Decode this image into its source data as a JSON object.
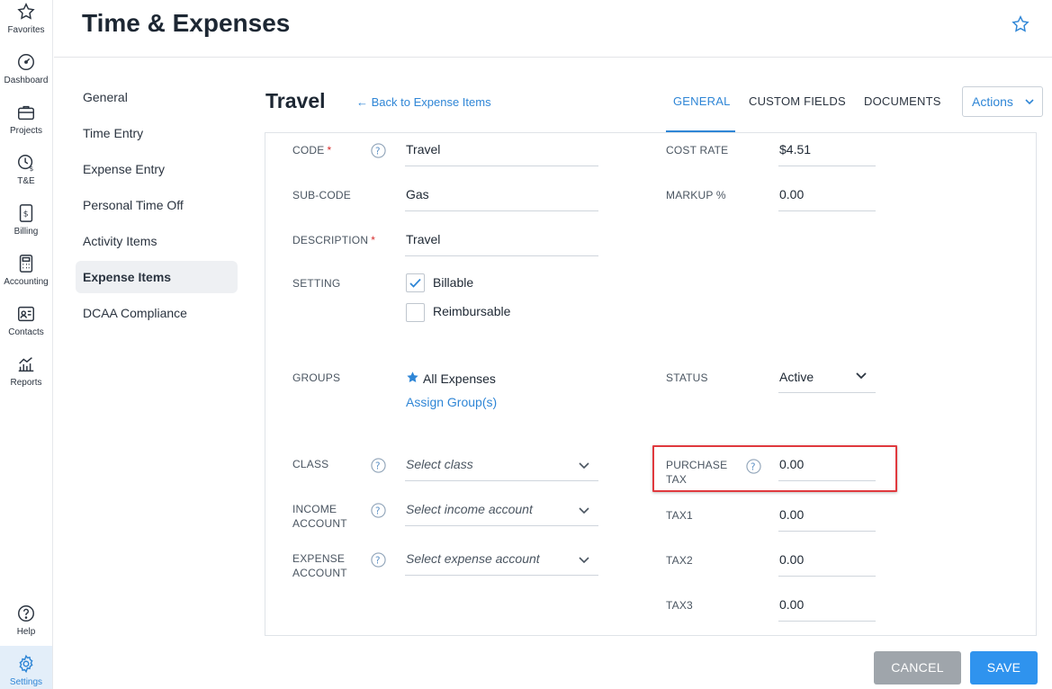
{
  "rail": {
    "items": [
      {
        "label": "Favorites",
        "icon": "star-icon"
      },
      {
        "label": "Dashboard",
        "icon": "gauge-icon"
      },
      {
        "label": "Projects",
        "icon": "briefcase-icon"
      },
      {
        "label": "T&E",
        "icon": "clock-dollar-icon"
      },
      {
        "label": "Billing",
        "icon": "invoice-icon"
      },
      {
        "label": "Accounting",
        "icon": "calculator-icon"
      },
      {
        "label": "Contacts",
        "icon": "contact-card-icon"
      },
      {
        "label": "Reports",
        "icon": "chart-icon"
      }
    ],
    "help": "Help",
    "settings": "Settings"
  },
  "header": {
    "title": "Time & Expenses"
  },
  "subnav": {
    "items": [
      "General",
      "Time Entry",
      "Expense Entry",
      "Personal Time Off",
      "Activity Items",
      "Expense Items",
      "DCAA Compliance"
    ],
    "active": "Expense Items"
  },
  "detail": {
    "title": "Travel",
    "back_link": "Back to Expense Items",
    "tabs": [
      "GENERAL",
      "CUSTOM FIELDS",
      "DOCUMENTS"
    ],
    "actions_label": "Actions"
  },
  "form": {
    "code_label": "CODE",
    "code_value": "Travel",
    "subcode_label": "SUB-CODE",
    "subcode_value": "Gas",
    "description_label": "DESCRIPTION",
    "description_value": "Travel",
    "setting_label": "SETTING",
    "billable_label": "Billable",
    "billable_checked": true,
    "reimbursable_label": "Reimbursable",
    "reimbursable_checked": false,
    "groups_label": "GROUPS",
    "groups_value": "All Expenses",
    "assign_groups": "Assign Group(s)",
    "class_label": "CLASS",
    "class_placeholder": "Select class",
    "income_label_1": "INCOME",
    "income_label_2": "ACCOUNT",
    "income_placeholder": "Select income account",
    "expense_label_1": "EXPENSE",
    "expense_label_2": "ACCOUNT",
    "expense_placeholder": "Select expense account",
    "cost_rate_label": "COST RATE",
    "cost_rate_value": "$4.51",
    "markup_label": "MARKUP %",
    "markup_value": "0.00",
    "status_label": "STATUS",
    "status_value": "Active",
    "purchase_tax_label_1": "PURCHASE",
    "purchase_tax_label_2": "TAX",
    "purchase_tax_value": "0.00",
    "tax1_label": "TAX1",
    "tax1_value": "0.00",
    "tax2_label": "TAX2",
    "tax2_value": "0.00",
    "tax3_label": "TAX3",
    "tax3_value": "0.00"
  },
  "footer": {
    "cancel": "CANCEL",
    "save": "SAVE"
  },
  "colors": {
    "accent": "#2f86d6",
    "highlight": "#e0393e",
    "cancel": "#9fa5ab",
    "save": "#2f93ee"
  }
}
